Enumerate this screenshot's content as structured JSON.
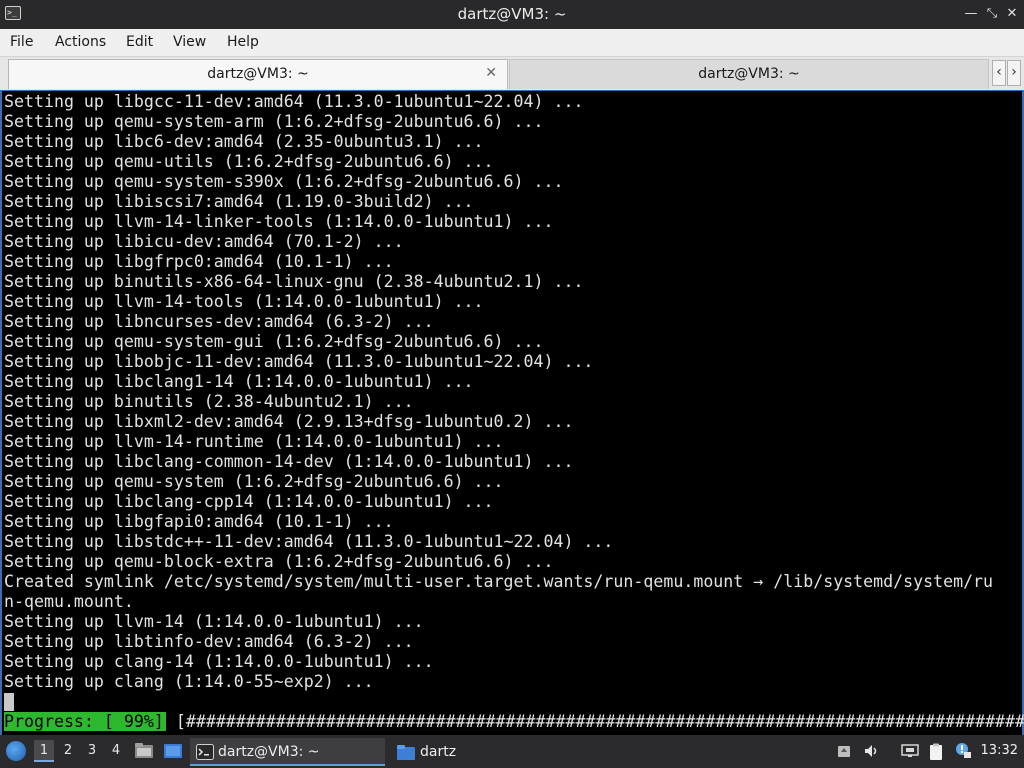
{
  "window": {
    "title": "dartz@VM3: ~",
    "controls": [
      "minimize-icon",
      "maximize-icon",
      "close-icon"
    ]
  },
  "menu": [
    "File",
    "Actions",
    "Edit",
    "View",
    "Help"
  ],
  "tabs": [
    {
      "label": "dartz@VM3: ~",
      "active": true
    },
    {
      "label": "dartz@VM3: ~",
      "active": false
    }
  ],
  "terminal": {
    "lines": [
      "Setting up libgcc-11-dev:amd64 (11.3.0-1ubuntu1~22.04) ...",
      "Setting up qemu-system-arm (1:6.2+dfsg-2ubuntu6.6) ...",
      "Setting up libc6-dev:amd64 (2.35-0ubuntu3.1) ...",
      "Setting up qemu-utils (1:6.2+dfsg-2ubuntu6.6) ...",
      "Setting up qemu-system-s390x (1:6.2+dfsg-2ubuntu6.6) ...",
      "Setting up libiscsi7:amd64 (1.19.0-3build2) ...",
      "Setting up llvm-14-linker-tools (1:14.0.0-1ubuntu1) ...",
      "Setting up libicu-dev:amd64 (70.1-2) ...",
      "Setting up libgfrpc0:amd64 (10.1-1) ...",
      "Setting up binutils-x86-64-linux-gnu (2.38-4ubuntu2.1) ...",
      "Setting up llvm-14-tools (1:14.0.0-1ubuntu1) ...",
      "Setting up libncurses-dev:amd64 (6.3-2) ...",
      "Setting up qemu-system-gui (1:6.2+dfsg-2ubuntu6.6) ...",
      "Setting up libobjc-11-dev:amd64 (11.3.0-1ubuntu1~22.04) ...",
      "Setting up libclang1-14 (1:14.0.0-1ubuntu1) ...",
      "Setting up binutils (2.38-4ubuntu2.1) ...",
      "Setting up libxml2-dev:amd64 (2.9.13+dfsg-1ubuntu0.2) ...",
      "Setting up llvm-14-runtime (1:14.0.0-1ubuntu1) ...",
      "Setting up libclang-common-14-dev (1:14.0.0-1ubuntu1) ...",
      "Setting up qemu-system (1:6.2+dfsg-2ubuntu6.6) ...",
      "Setting up libclang-cpp14 (1:14.0.0-1ubuntu1) ...",
      "Setting up libgfapi0:amd64 (10.1-1) ...",
      "Setting up libstdc++-11-dev:amd64 (11.3.0-1ubuntu1~22.04) ...",
      "Setting up qemu-block-extra (1:6.2+dfsg-2ubuntu6.6) ...",
      "Created symlink /etc/systemd/system/multi-user.target.wants/run-qemu.mount → /lib/systemd/system/ru",
      "n-qemu.mount.",
      "Setting up llvm-14 (1:14.0.0-1ubuntu1) ...",
      "Setting up libtinfo-dev:amd64 (6.3-2) ...",
      "Setting up clang-14 (1:14.0.0-1ubuntu1) ...",
      "Setting up clang (1:14.0-55~exp2) ..."
    ],
    "progress_label": "Progress: [ 99%]",
    "progress_bar": "[#####################################################################################.]",
    "progress_percent": 99,
    "colors": {
      "progress_bg": "#2db82d",
      "text": "#e2e2e2",
      "background": "#000000"
    }
  },
  "taskbar": {
    "workspaces": [
      "1",
      "2",
      "3",
      "4"
    ],
    "active_workspace": "1",
    "tasks": [
      {
        "label": "dartz@VM3: ~",
        "icon": "terminal-icon",
        "active": true
      },
      {
        "label": "dartz",
        "icon": "folder-icon",
        "active": false
      }
    ],
    "tray": [
      "usb-drive-icon",
      "volume-icon",
      "network-icon",
      "clipboard-icon",
      "update-notifier-icon"
    ],
    "clock": "13:32"
  }
}
